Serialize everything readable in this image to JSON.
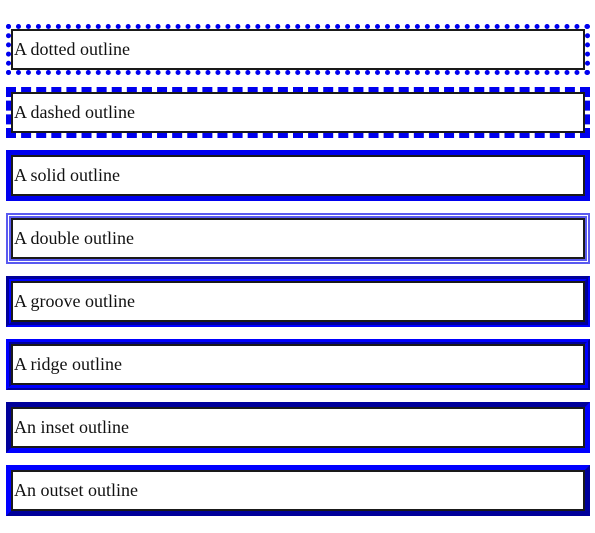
{
  "outline_color": "#0000ee",
  "boxes": [
    {
      "style": "dotted",
      "label": "A dotted outline"
    },
    {
      "style": "dashed",
      "label": "A dashed outline"
    },
    {
      "style": "solid",
      "label": "A solid outline"
    },
    {
      "style": "double",
      "label": "A double outline"
    },
    {
      "style": "groove",
      "label": "A groove outline"
    },
    {
      "style": "ridge",
      "label": "A ridge outline"
    },
    {
      "style": "inset",
      "label": "An inset outline"
    },
    {
      "style": "outset",
      "label": "An outset outline"
    }
  ]
}
